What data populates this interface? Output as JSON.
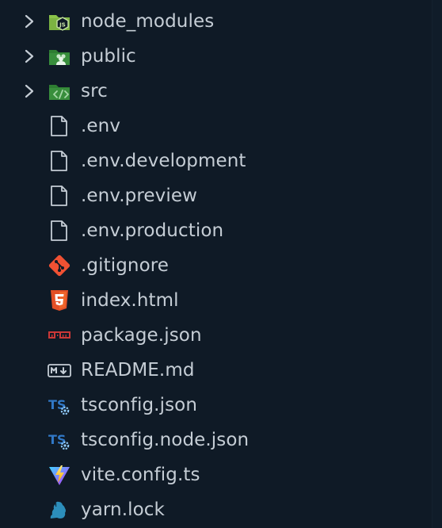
{
  "explorer": {
    "items": [
      {
        "label": "node_modules",
        "kind": "folder",
        "icon": "folder-node-icon"
      },
      {
        "label": "public",
        "kind": "folder",
        "icon": "folder-public-icon"
      },
      {
        "label": "src",
        "kind": "folder",
        "icon": "folder-src-icon"
      },
      {
        "label": ".env",
        "kind": "file",
        "icon": "file-icon"
      },
      {
        "label": ".env.development",
        "kind": "file",
        "icon": "file-icon"
      },
      {
        "label": ".env.preview",
        "kind": "file",
        "icon": "file-icon"
      },
      {
        "label": ".env.production",
        "kind": "file",
        "icon": "file-icon"
      },
      {
        "label": ".gitignore",
        "kind": "file",
        "icon": "git-icon"
      },
      {
        "label": "index.html",
        "kind": "file",
        "icon": "html5-icon"
      },
      {
        "label": "package.json",
        "kind": "file",
        "icon": "npm-icon"
      },
      {
        "label": "README.md",
        "kind": "file",
        "icon": "markdown-icon"
      },
      {
        "label": "tsconfig.json",
        "kind": "file",
        "icon": "tsconfig-icon"
      },
      {
        "label": "tsconfig.node.json",
        "kind": "file",
        "icon": "tsconfig-icon"
      },
      {
        "label": "vite.config.ts",
        "kind": "file",
        "icon": "vite-icon"
      },
      {
        "label": "yarn.lock",
        "kind": "file",
        "icon": "yarn-icon"
      }
    ]
  },
  "colors": {
    "background": "#0f1a26",
    "text": "#c5cdd5",
    "folder_green": "#4caf50",
    "git_orange": "#f05133",
    "html_orange": "#e34f26",
    "npm_red": "#cb3837",
    "ts_blue": "#3178c6",
    "yarn_blue": "#2c8ebb"
  }
}
